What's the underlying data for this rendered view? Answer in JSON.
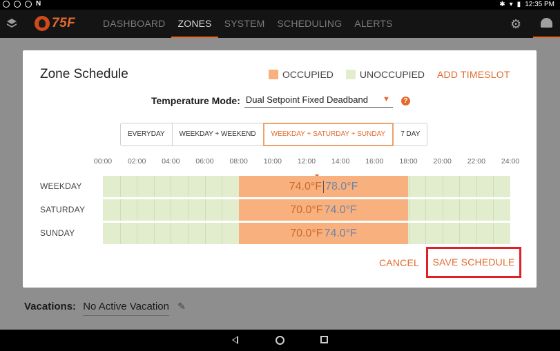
{
  "status_bar": {
    "time": "12:35 PM",
    "left_icons": [
      "circle-icon",
      "clock-icon",
      "sync-icon",
      "n-icon"
    ],
    "right_icons": [
      "bluetooth-icon",
      "wifi-icon",
      "battery-icon"
    ]
  },
  "app_bar": {
    "logo_text": "75F",
    "tabs": [
      {
        "label": "DASHBOARD",
        "active": false
      },
      {
        "label": "ZONES",
        "active": true
      },
      {
        "label": "SYSTEM",
        "active": false
      },
      {
        "label": "SCHEDULING",
        "active": false
      },
      {
        "label": "ALERTS",
        "active": false
      }
    ]
  },
  "dialog": {
    "title": "Zone Schedule",
    "legend": {
      "occupied": "OCCUPIED",
      "unoccupied": "UNOCCUPIED"
    },
    "add_timeslot": "ADD TIMESLOT",
    "temperature_mode": {
      "label": "Temperature Mode:",
      "value": "Dual Setpoint Fixed Deadband",
      "help": "?"
    },
    "schedule_types": [
      {
        "label": "EVERYDAY",
        "active": false
      },
      {
        "label": "WEEKDAY + WEEKEND",
        "active": false
      },
      {
        "label": "WEEKDAY + SATURDAY + SUNDAY",
        "active": true
      },
      {
        "label": "7 DAY",
        "active": false
      }
    ],
    "hours": [
      "00:00",
      "02:00",
      "04:00",
      "06:00",
      "08:00",
      "10:00",
      "12:00",
      "14:00",
      "16:00",
      "18:00",
      "20:00",
      "22:00",
      "24:00"
    ],
    "rows": [
      {
        "day": "WEEKDAY",
        "occupied_start_hour": 8,
        "occupied_end_hour": 18,
        "heating": "74.0°F",
        "cooling": "78.0°F"
      },
      {
        "day": "SATURDAY",
        "occupied_start_hour": 8,
        "occupied_end_hour": 18,
        "heating": "70.0°F",
        "cooling": "74.0°F"
      },
      {
        "day": "SUNDAY",
        "occupied_start_hour": 8,
        "occupied_end_hour": 18,
        "heating": "70.0°F",
        "cooling": "74.0°F"
      }
    ],
    "current_time_hour": 12.6,
    "cancel": "CANCEL",
    "save": "SAVE SCHEDULE"
  },
  "background": {
    "vacations_label": "Vacations:",
    "vacations_value": "No Active Vacation"
  },
  "colors": {
    "accent": "#e36a2c",
    "occupied": "#f8b07e",
    "unoccupied": "#e1edcc",
    "highlight_box": "#e41e26"
  }
}
